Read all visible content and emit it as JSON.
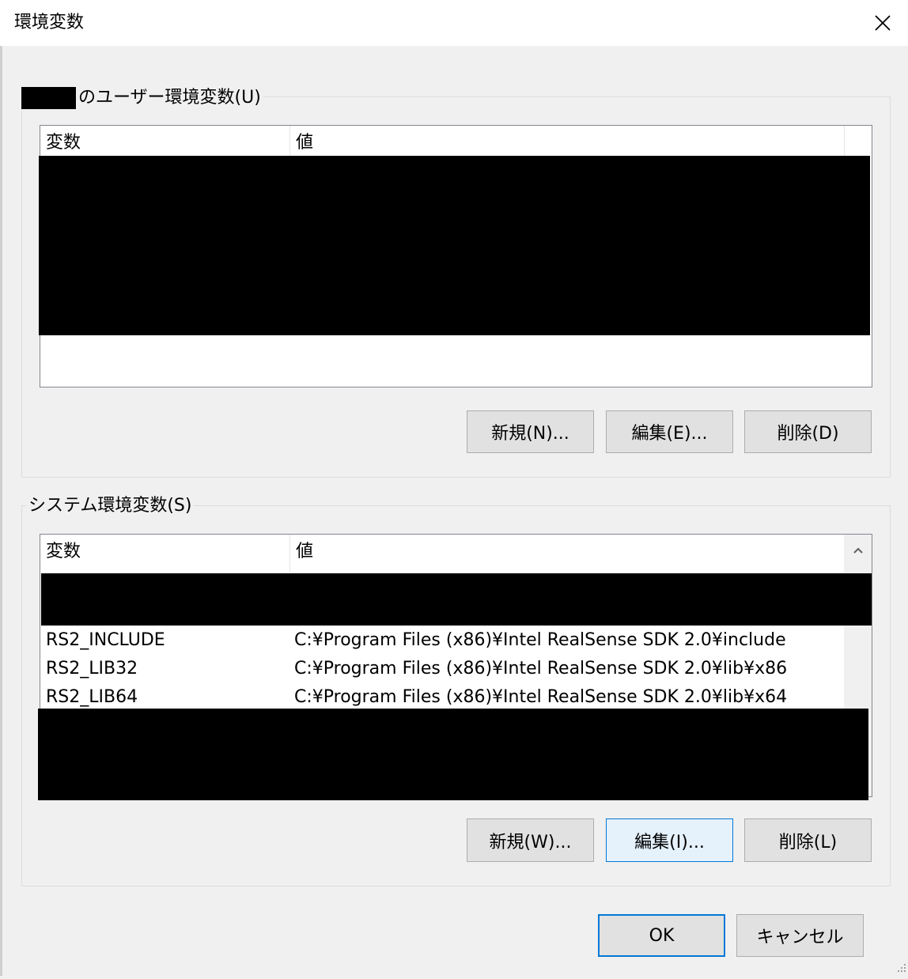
{
  "window": {
    "title": "環境変数",
    "close_icon": "close-icon"
  },
  "user_vars": {
    "legend": "のユーザー環境変数(U)",
    "columns": [
      "変数",
      "値"
    ],
    "buttons": {
      "new": "新規(N)...",
      "edit": "編集(E)...",
      "delete": "削除(D)"
    }
  },
  "system_vars": {
    "legend": "システム環境変数(S)",
    "columns": [
      "変数",
      "値"
    ],
    "rows": [
      {
        "name": "RS2_INCLUDE",
        "value": "C:¥Program Files (x86)¥Intel RealSense SDK 2.0¥include"
      },
      {
        "name": "RS2_LIB32",
        "value": "C:¥Program Files (x86)¥Intel RealSense SDK 2.0¥lib¥x86"
      },
      {
        "name": "RS2_LIB64",
        "value": "C:¥Program Files (x86)¥Intel RealSense SDK 2.0¥lib¥x64"
      }
    ],
    "buttons": {
      "new": "新規(W)...",
      "edit": "編集(I)...",
      "delete": "削除(L)"
    },
    "scroll_up_icon": "chevron-up-icon"
  },
  "footer": {
    "ok": "OK",
    "cancel": "キャンセル"
  },
  "colors": {
    "accent": "#0078d7",
    "window_bg": "#f0f0f0",
    "button_bg": "#e1e1e1",
    "list_border": "#828790"
  }
}
